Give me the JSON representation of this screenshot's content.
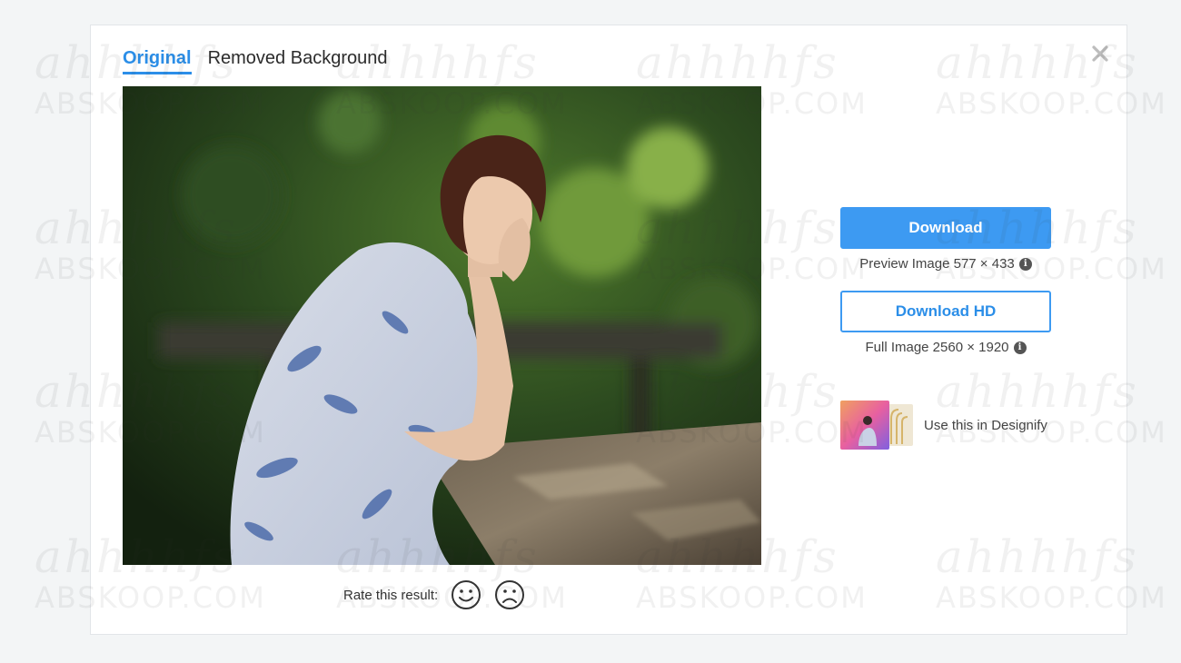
{
  "tabs": [
    {
      "label": "Original",
      "active": true
    },
    {
      "label": "Removed Background",
      "active": false
    }
  ],
  "close": {
    "icon": "close-icon"
  },
  "photo": {
    "icon": "photo-image"
  },
  "rating": {
    "label": "Rate this result:",
    "icons": [
      "smile-icon",
      "frown-icon"
    ]
  },
  "download": {
    "label": "Download",
    "note": "Preview Image 577 × 433",
    "info_icon": "i"
  },
  "download_hd": {
    "label": "Download HD",
    "note": "Full Image 2560 × 1920",
    "info_icon": "i"
  },
  "designify": {
    "label": "Use this in Designify",
    "icon": "designify-thumbnail"
  },
  "watermark": {
    "line1": "ahhhhfs",
    "line2": "ABSKOOP.COM"
  },
  "colors": {
    "accent": "#3d9af2",
    "accent_text": "#2b8ee8",
    "background": "#f3f5f6",
    "panel": "#ffffff"
  }
}
